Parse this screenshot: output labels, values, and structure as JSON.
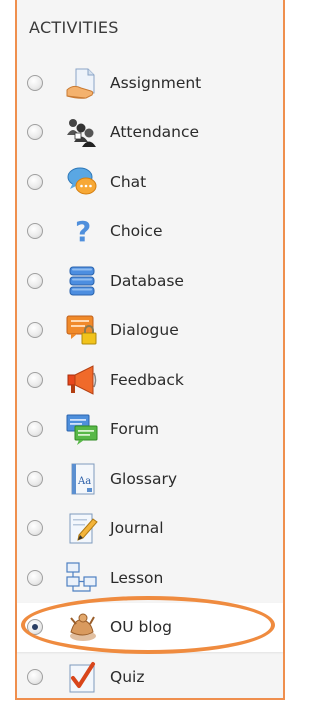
{
  "panel": {
    "heading": "ACTIVITIES"
  },
  "activities": [
    {
      "label": "Assignment",
      "icon": "assignment-icon",
      "selected": false
    },
    {
      "label": "Attendance",
      "icon": "attendance-icon",
      "selected": false
    },
    {
      "label": "Chat",
      "icon": "chat-icon",
      "selected": false
    },
    {
      "label": "Choice",
      "icon": "choice-icon",
      "selected": false
    },
    {
      "label": "Database",
      "icon": "database-icon",
      "selected": false
    },
    {
      "label": "Dialogue",
      "icon": "dialogue-icon",
      "selected": false
    },
    {
      "label": "Feedback",
      "icon": "feedback-icon",
      "selected": false
    },
    {
      "label": "Forum",
      "icon": "forum-icon",
      "selected": false
    },
    {
      "label": "Glossary",
      "icon": "glossary-icon",
      "selected": false
    },
    {
      "label": "Journal",
      "icon": "journal-icon",
      "selected": false
    },
    {
      "label": "Lesson",
      "icon": "lesson-icon",
      "selected": false
    },
    {
      "label": "OU blog",
      "icon": "ou-blog-icon",
      "selected": true
    },
    {
      "label": "Quiz",
      "icon": "quiz-icon",
      "selected": false
    }
  ],
  "colors": {
    "accent_border": "#ef8f4e",
    "highlight_ellipse": "#ef8b3f",
    "panel_background": "#f5f5f5"
  }
}
